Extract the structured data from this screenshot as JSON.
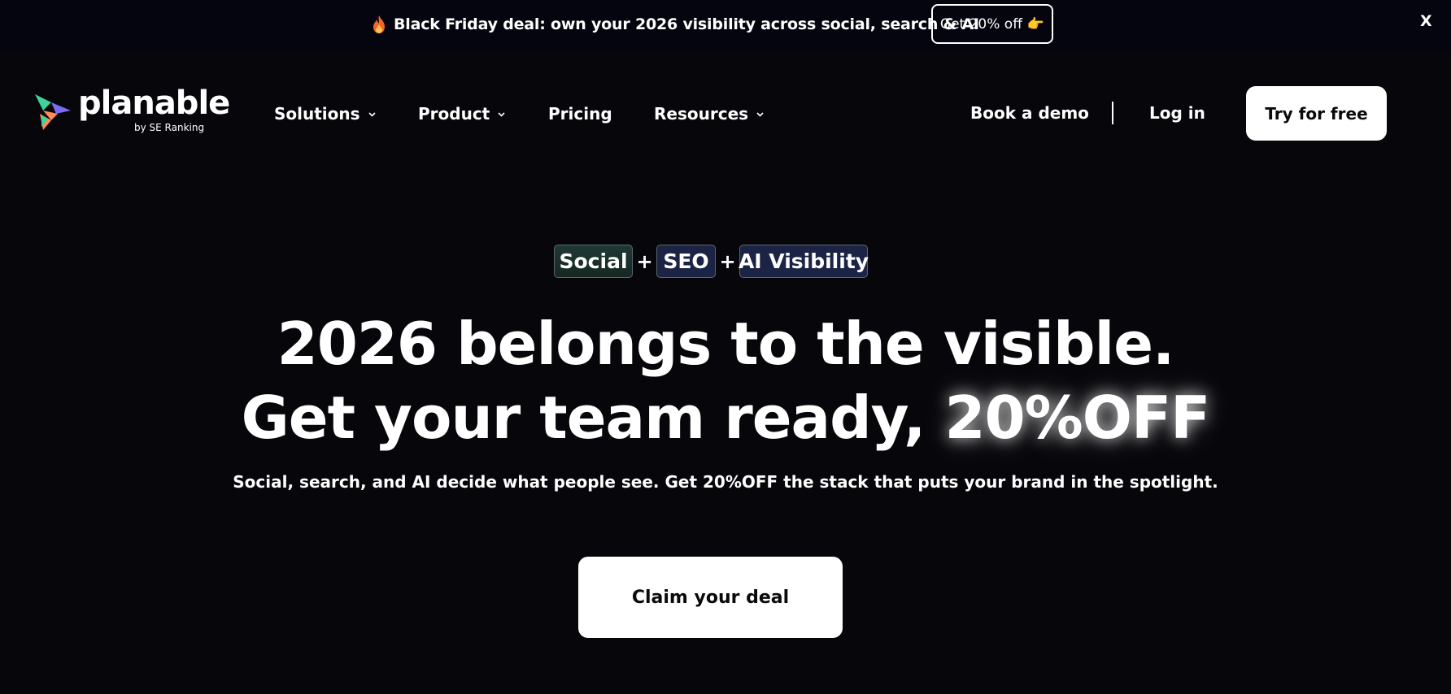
{
  "promo": {
    "icon": "flame-icon",
    "text": "Black Friday deal: own your 2026 visibility across social, search & AI",
    "button_label": "Get 20% off",
    "button_icon": "pointing-hand-icon",
    "close_label": "X"
  },
  "header": {
    "logo_word": "planable",
    "logo_sub": "by SE Ranking",
    "nav": [
      {
        "label": "Solutions",
        "has_dropdown": true
      },
      {
        "label": "Product",
        "has_dropdown": true
      },
      {
        "label": "Pricing",
        "has_dropdown": false
      },
      {
        "label": "Resources",
        "has_dropdown": true
      }
    ],
    "book_demo": "Book a demo",
    "login": "Log in",
    "try_free": "Try for free"
  },
  "hero": {
    "pills": [
      "Social",
      "SEO",
      "AI Visibility"
    ],
    "plus": "+",
    "line1": "2026 belongs to the visible.",
    "line2_prefix": "Get your team ready, ",
    "line2_highlight": "20%OFF",
    "subtitle": "Social, search, and AI decide what people see. Get 20%OFF the stack that puts your brand in the spotlight.",
    "cta": "Claim your deal"
  },
  "colors": {
    "background": "#07070b",
    "promo_background": "#04050f",
    "text": "#ffffff",
    "button_background": "#ffffff",
    "button_text": "#0a0a0a",
    "pill_social": "#1f3a33",
    "pill_blue": "#1c2446"
  }
}
